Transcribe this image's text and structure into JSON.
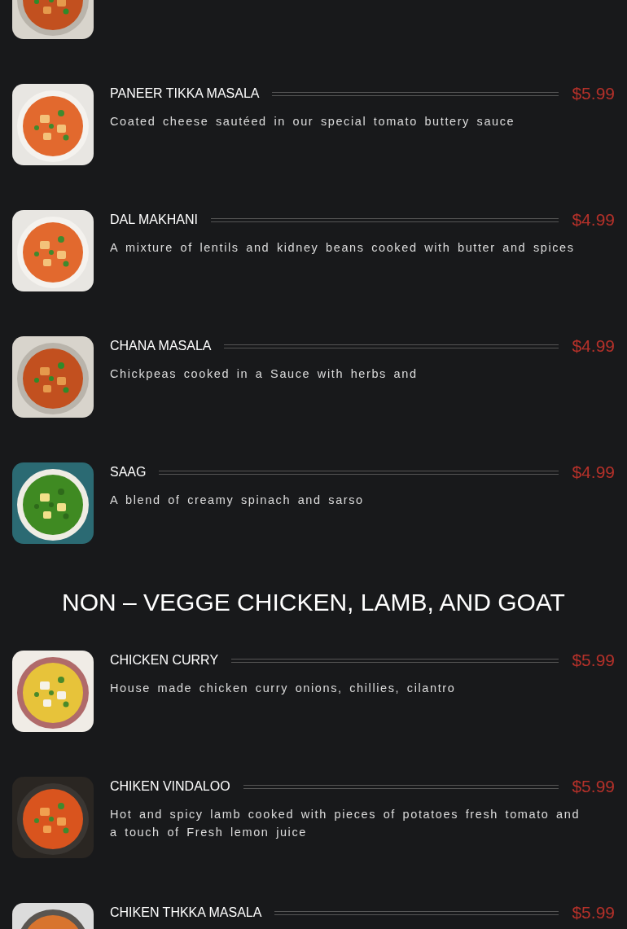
{
  "sections": [
    {
      "items": [
        {
          "title": "PANEER TIKKA MASALA",
          "description": "Coated cheese sautéed in our special tomato buttery sauce",
          "price": "$5.99"
        },
        {
          "title": "DAL MAKHANI",
          "description": "A mixture of lentils and kidney beans cooked with butter and spices",
          "price": "$4.99"
        },
        {
          "title": "CHANA MASALA",
          "description": "Chickpeas cooked in a Sauce with herbs and",
          "price": "$4.99"
        },
        {
          "title": "SAAG",
          "description": "A blend of creamy spinach and sarso",
          "price": "$4.99"
        }
      ]
    },
    {
      "heading": "NON – VEGGE CHICKEN, LAMB, AND GOAT",
      "items": [
        {
          "title": "CHICKEN CURRY",
          "description": "House made chicken curry onions, chillies, cilantro",
          "price": "$5.99"
        },
        {
          "title": "CHIKEN VINDALOO",
          "description": "Hot and spicy lamb cooked with pieces of potatoes fresh tomato and a touch of Fresh lemon juice",
          "price": "$5.99"
        },
        {
          "title": "CHIKEN THKKA MASALA",
          "price": "$5.99"
        }
      ]
    }
  ]
}
